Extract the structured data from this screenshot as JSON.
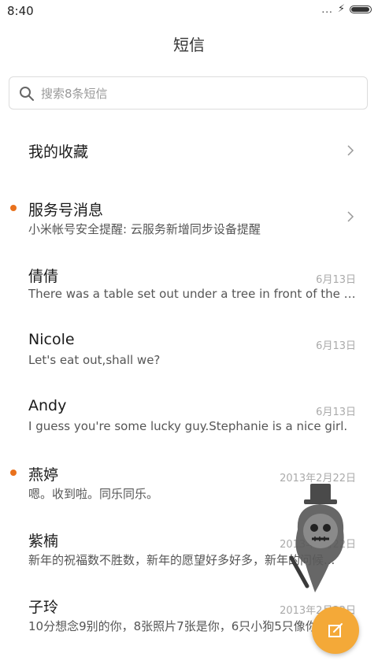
{
  "status_bar": {
    "time": "8:40",
    "signal_dots": "...",
    "charging_icon": "bolt-icon",
    "battery_level": 0.95
  },
  "header": {
    "title": "短信"
  },
  "search": {
    "placeholder": "搜索8条短信",
    "icon": "search-icon"
  },
  "favorites": {
    "label": "我的收藏",
    "icon": "chevron-right-icon"
  },
  "service": {
    "name": "服务号消息",
    "snippet": "小米帐号安全提醒: 云服务新增同步设备提醒",
    "unread": true,
    "icon": "chevron-right-icon"
  },
  "conversations": [
    {
      "name": "倩倩",
      "snippet": "There was a table set out under a tree in front of the ho...",
      "date": "6月13日",
      "unread": false
    },
    {
      "name": "Nicole",
      "snippet": "Let's eat out,shall we?",
      "date": "6月13日",
      "unread": false
    },
    {
      "name": "Andy",
      "snippet": "I guess you're some lucky guy.Stephanie is a nice girl.",
      "date": "6月13日",
      "unread": false
    },
    {
      "name": "燕婷",
      "snippet": "嗯。收到啦。同乐同乐。",
      "date": "2013年2月22日",
      "unread": true
    },
    {
      "name": "紫楠",
      "snippet": "新年的祝福数不胜数，新年的愿望好多好多，新年的问候...",
      "date": "2013年2月22日",
      "unread": false
    },
    {
      "name": "子玲",
      "snippet": "10分想念9别的你，8张照片7张是你，6只小狗5只像你...",
      "date": "2013年2月22日",
      "unread": false
    }
  ],
  "fab": {
    "icon": "compose-icon"
  },
  "colors": {
    "accent": "#e9711c",
    "fab": "#f4a938"
  }
}
